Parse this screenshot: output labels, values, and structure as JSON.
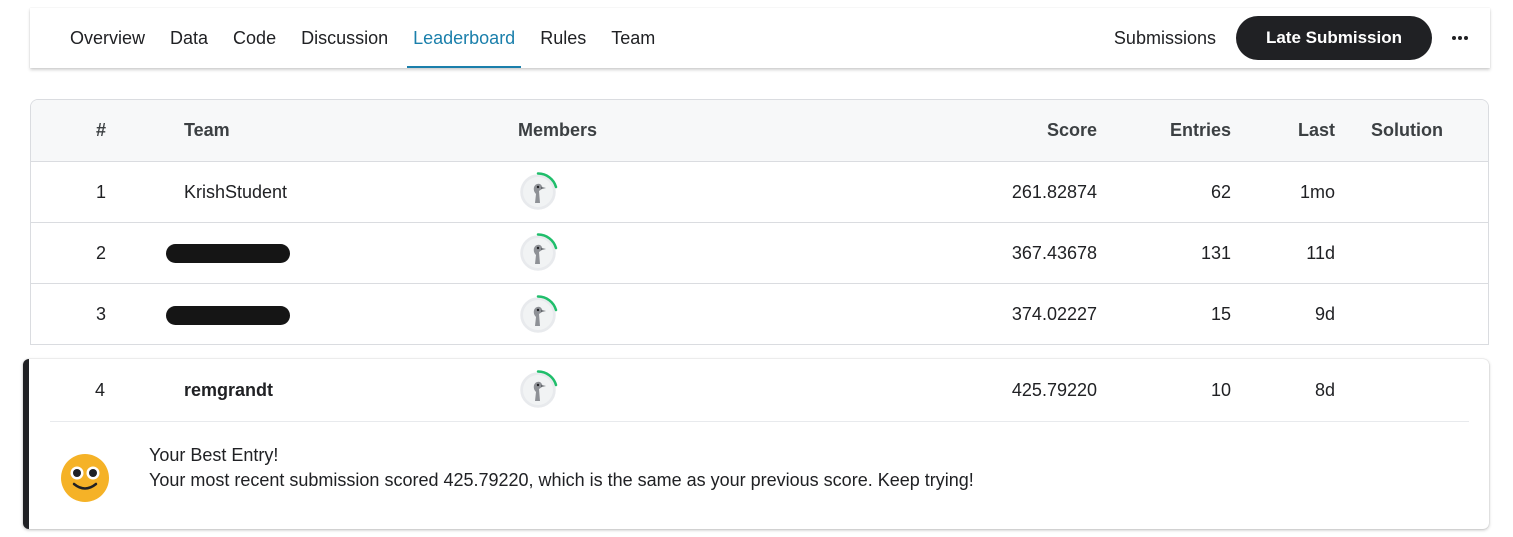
{
  "nav": {
    "tabs": [
      {
        "label": "Overview"
      },
      {
        "label": "Data"
      },
      {
        "label": "Code"
      },
      {
        "label": "Discussion"
      },
      {
        "label": "Leaderboard",
        "active": true
      },
      {
        "label": "Rules"
      },
      {
        "label": "Team"
      }
    ],
    "submissions_label": "Submissions",
    "late_submission_label": "Late Submission",
    "more_label": "•••"
  },
  "leaderboard": {
    "columns": {
      "rank": "#",
      "team": "Team",
      "members": "Members",
      "score": "Score",
      "entries": "Entries",
      "last": "Last",
      "solution": "Solution"
    },
    "rows": [
      {
        "rank": "1",
        "team": "KrishStudent",
        "score": "261.82874",
        "entries": "62",
        "last": "1mo",
        "redacted": false
      },
      {
        "rank": "2",
        "team": "",
        "score": "367.43678",
        "entries": "131",
        "last": "11d",
        "redacted": true
      },
      {
        "rank": "3",
        "team": "",
        "score": "374.02227",
        "entries": "15",
        "last": "9d",
        "redacted": true
      }
    ],
    "current_user": {
      "rank": "4",
      "team": "remgrandt",
      "score": "425.79220",
      "entries": "10",
      "last": "8d",
      "message_title": "Your Best Entry!",
      "message_body": "Your most recent submission scored 425.79220, which is the same as your previous score. Keep trying!"
    }
  },
  "colors": {
    "accent": "#1a7fab",
    "button_dark": "#202124",
    "avatar_ring": "#20be6b",
    "emoji_yellow": "#f5b227"
  },
  "icons": {
    "avatar": "ostrich-avatar-icon",
    "emoji": "smiling-face-icon",
    "more": "more-horizontal-icon"
  }
}
